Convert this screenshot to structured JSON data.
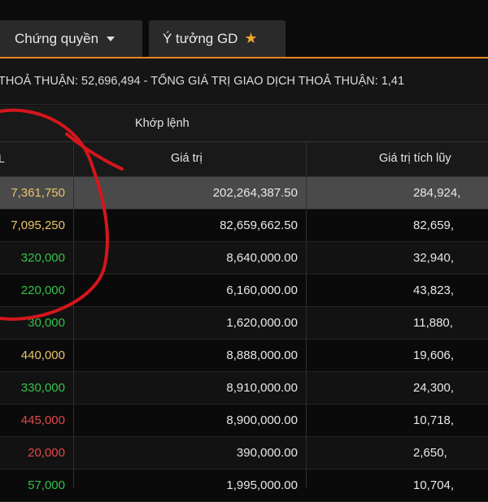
{
  "tabs": [
    {
      "label": "Chứng quyền",
      "icon": "chevron-down-icon"
    },
    {
      "label": "Ý tưởng GD",
      "icon": "star-icon"
    }
  ],
  "ticker": "THOẢ THUẬN: 52,696,494  -  TỔNG GIÁ TRỊ GIAO DỊCH THOẢ THUẬN: 1,41",
  "group_header": "Khớp lệnh",
  "columns": [
    "L",
    "Giá trị",
    "Giá trị tích lũy"
  ],
  "rows": [
    {
      "volume": "7,361,750",
      "value": "202,264,387.50",
      "accum": "284,924,",
      "color": "#e9c46a"
    },
    {
      "volume": "7,095,250",
      "value": "82,659,662.50",
      "accum": "82,659,",
      "color": "#e9c46a"
    },
    {
      "volume": "320,000",
      "value": "8,640,000.00",
      "accum": "32,940,",
      "color": "#35c24a"
    },
    {
      "volume": "220,000",
      "value": "6,160,000.00",
      "accum": "43,823,",
      "color": "#35c24a"
    },
    {
      "volume": "30,000",
      "value": "1,620,000.00",
      "accum": "11,880,",
      "color": "#35c24a"
    },
    {
      "volume": "440,000",
      "value": "8,888,000.00",
      "accum": "19,606,",
      "color": "#e9c46a"
    },
    {
      "volume": "330,000",
      "value": "8,910,000.00",
      "accum": "24,300,",
      "color": "#35c24a"
    },
    {
      "volume": "445,000",
      "value": "8,900,000.00",
      "accum": "10,718,",
      "color": "#e54848"
    },
    {
      "volume": "20,000",
      "value": "390,000.00",
      "accum": "2,650,",
      "color": "#e54848"
    },
    {
      "volume": "57,000",
      "value": "1,995,000.00",
      "accum": "10,704,",
      "color": "#35c24a"
    }
  ],
  "annotation_color": "#d4161c"
}
